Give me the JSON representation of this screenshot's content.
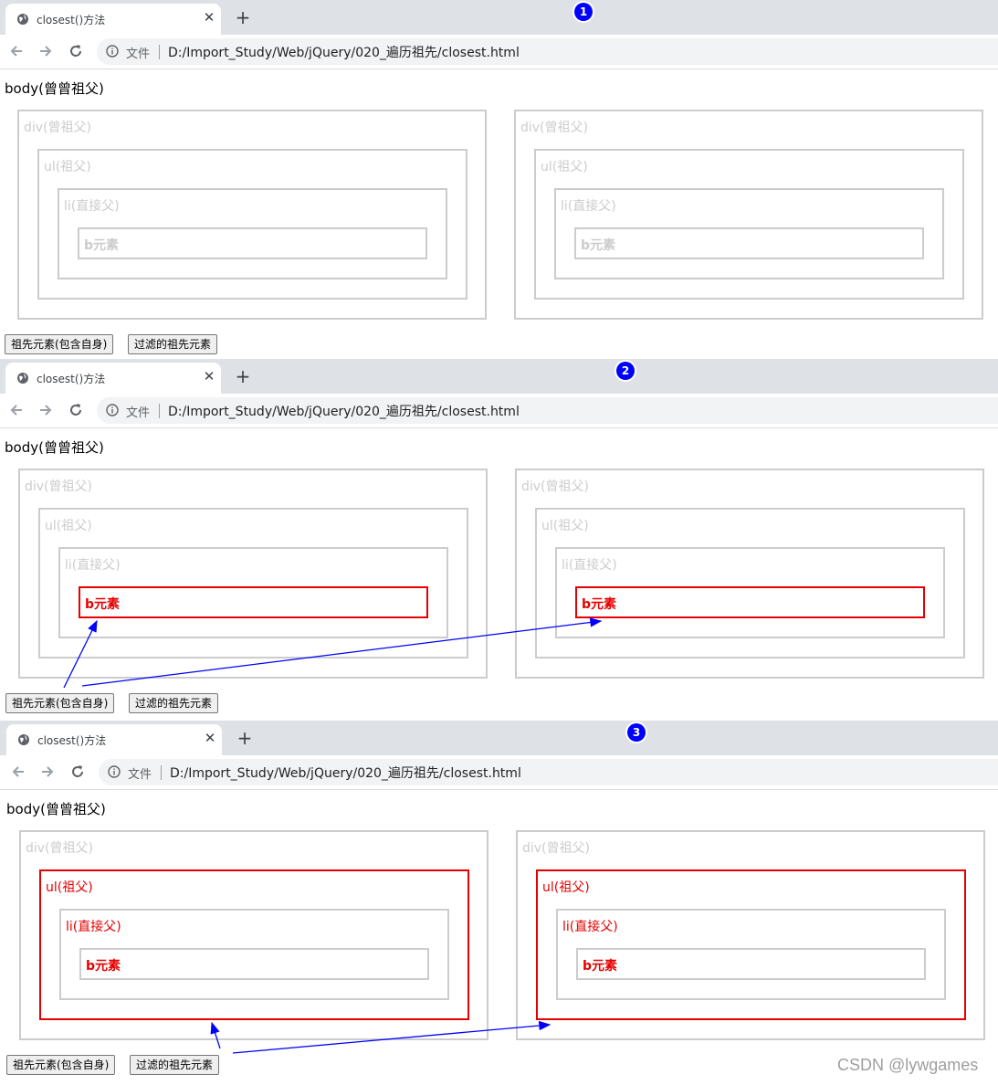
{
  "colors": {
    "highlight": "#e60000",
    "arrow": "#0000ff",
    "box_border": "#cccccc"
  },
  "tab_title": "closest()方法",
  "file_label": "文件",
  "url": "D:/Import_Study/Web/jQuery/020_遍历祖先/closest.html",
  "body_text": "body(曾曾祖父)",
  "labels": {
    "div": "div(曾祖父)",
    "ul": "ul(祖父)",
    "li": "li(直接父)",
    "b": "b元素"
  },
  "buttons": {
    "ancestor": "祖先元素(包含自身)",
    "filtered": "过滤的祖先元素"
  },
  "panels": [
    {
      "step": "1",
      "highlight": "none"
    },
    {
      "step": "2",
      "highlight": "b"
    },
    {
      "step": "3",
      "highlight": "ul"
    }
  ],
  "watermark": "CSDN @lywgames"
}
